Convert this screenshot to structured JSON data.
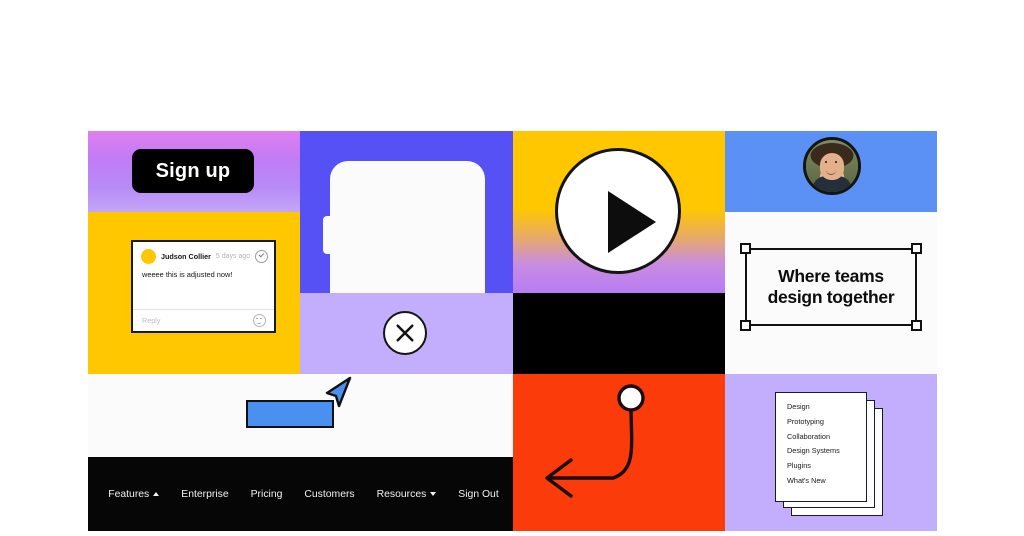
{
  "collage": {
    "signup": {
      "button_label": "Sign up"
    },
    "comment": {
      "author": "Judson Collier",
      "timestamp": "5 days ago",
      "message": "weeee this is adjusted now!",
      "reply_placeholder": "Reply",
      "resolve_icon": "check-circle-icon",
      "emoji_icon": "emoji-reaction-icon",
      "pin_icon": "comment-pin-cursor-icon"
    },
    "frame": {
      "icon": "device-frame-icon"
    },
    "close": {
      "icon": "close-circle-icon"
    },
    "play": {
      "icon": "play-button-icon"
    },
    "avatar": {
      "icon": "user-avatar-photo"
    },
    "tagline": {
      "line1": "Where teams",
      "line2": "design together",
      "selection_icon": "selection-handles-icon"
    },
    "canvas": {
      "rect_icon": "blue-rectangle-shape",
      "cursor_icon": "pointer-cursor-icon"
    },
    "nav": {
      "items": [
        {
          "label": "Features",
          "caret": "up"
        },
        {
          "label": "Enterprise",
          "caret": "none"
        },
        {
          "label": "Pricing",
          "caret": "none"
        },
        {
          "label": "Customers",
          "caret": "none"
        },
        {
          "label": "Resources",
          "caret": "down"
        },
        {
          "label": "Sign Out",
          "caret": "none"
        }
      ]
    },
    "arrow": {
      "icon": "curved-arrow-with-handle-icon"
    },
    "list_stack": {
      "items": [
        "Design",
        "Prototyping",
        "Collaboration",
        "Design Systems",
        "Plugins",
        "What's New"
      ]
    }
  },
  "colors": {
    "page_background": "#ffffff",
    "gradient_pink": "#e07ef0",
    "gradient_lavender": "#c4a7f9",
    "yellow": "#ffc700",
    "indigo": "#5551f5",
    "lavender": "#c2aefc",
    "blue": "#5b91f5",
    "orange_red": "#fb3b0a",
    "black": "#060606",
    "white": "#fbfbfb",
    "shape_blue": "#4a90f0"
  }
}
